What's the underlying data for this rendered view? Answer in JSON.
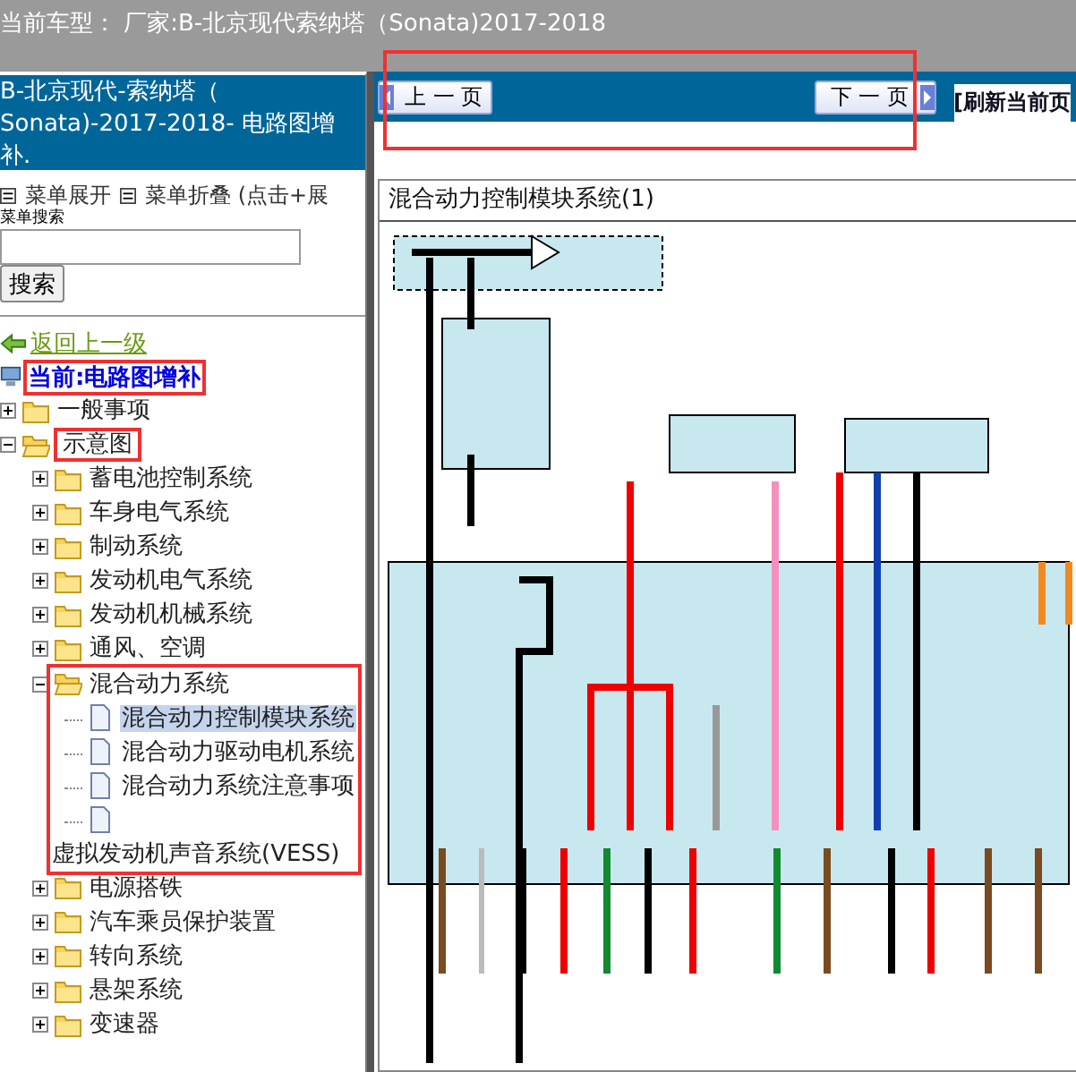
{
  "header": {
    "text": "当前车型： 厂家:B-北京现代索纳塔（Sonata)2017-2018"
  },
  "sidebar": {
    "title": "B-北京现代-索纳塔（ Sonata)-2017-2018- 电路图增补.",
    "menu_actions": [
      {
        "label": "菜单展开"
      },
      {
        "label": "菜单折叠 (点击+展"
      }
    ],
    "search": {
      "label": "菜单搜索",
      "button": "搜索"
    },
    "back_link": "返回上一级",
    "current": {
      "text": "当前:电路图增补",
      "highlighted": true
    },
    "tree": [
      {
        "label": "一般事项",
        "kind": "folder",
        "expanded": false,
        "selected": false,
        "highlighted": false
      },
      {
        "label": "示意图",
        "kind": "folder",
        "expanded": true,
        "selected": false,
        "highlighted": true,
        "children": [
          {
            "label": "蓄电池控制系统",
            "kind": "folder",
            "expanded": false,
            "selected": false,
            "highlighted": false
          },
          {
            "label": "车身电气系统",
            "kind": "folder",
            "expanded": false,
            "selected": false,
            "highlighted": false
          },
          {
            "label": "制动系统",
            "kind": "folder",
            "expanded": false,
            "selected": false,
            "highlighted": false
          },
          {
            "label": "发动机电气系统",
            "kind": "folder",
            "expanded": false,
            "selected": false,
            "highlighted": false
          },
          {
            "label": "发动机机械系统",
            "kind": "folder",
            "expanded": false,
            "selected": false,
            "highlighted": false
          },
          {
            "label": "通风、空调",
            "kind": "folder",
            "expanded": false,
            "selected": false,
            "highlighted": false
          },
          {
            "label": "混合动力系统",
            "kind": "folder",
            "expanded": true,
            "selected": false,
            "highlighted": true,
            "children": [
              {
                "label": "混合动力控制模块系统",
                "kind": "doc",
                "selected": true,
                "highlighted": false
              },
              {
                "label": "混合动力驱动电机系统",
                "kind": "doc",
                "selected": false,
                "highlighted": false
              },
              {
                "label": "混合动力系统注意事项",
                "kind": "doc",
                "selected": false,
                "highlighted": false
              },
              {
                "label": "虚拟发动机声音系统(VESS)",
                "kind": "doc",
                "selected": false,
                "highlighted": false
              }
            ]
          },
          {
            "label": "电源搭铁",
            "kind": "folder",
            "expanded": false,
            "selected": false,
            "highlighted": false
          },
          {
            "label": "汽车乘员保护装置",
            "kind": "folder",
            "expanded": false,
            "selected": false,
            "highlighted": false
          },
          {
            "label": "转向系统",
            "kind": "folder",
            "expanded": false,
            "selected": false,
            "highlighted": false
          },
          {
            "label": "悬架系统",
            "kind": "folder",
            "expanded": false,
            "selected": false,
            "highlighted": false
          },
          {
            "label": "变速器",
            "kind": "folder",
            "expanded": false,
            "selected": false,
            "highlighted": false
          }
        ]
      }
    ]
  },
  "nav": {
    "prev": "上 一 页",
    "next": "下 一 页",
    "refresh": "[刷新当前页",
    "highlighted": true
  },
  "document": {
    "title": "混合动力控制模块系统(1)"
  }
}
